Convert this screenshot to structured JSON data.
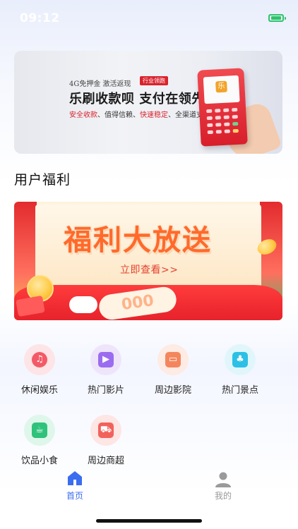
{
  "status_bar": {
    "time": "09:12"
  },
  "top_banner": {
    "promo_line": "4G免押金 激活返现",
    "tag": "行业领跑",
    "title": "乐刷收款呗 支付在领先",
    "features": [
      "安全收款",
      "值得信赖",
      "快速稳定",
      "全渠道支付"
    ],
    "device_logo": "乐"
  },
  "section": {
    "title": "用户福利"
  },
  "welfare_banner": {
    "title": "福利大放送",
    "cta": "立即查看>>",
    "ticket_text": "000"
  },
  "categories": [
    {
      "label": "休闲娱乐",
      "icon": "leisure-icon",
      "bg": "#fde4e6",
      "fg": "#f35a67",
      "glyph": "♫"
    },
    {
      "label": "热门影片",
      "icon": "movie-icon",
      "bg": "#efe5fb",
      "fg": "#9b6cf0",
      "glyph": "▶"
    },
    {
      "label": "周边影院",
      "icon": "cinema-icon",
      "bg": "#fdebe4",
      "fg": "#f4865d",
      "glyph": "▭"
    },
    {
      "label": "热门景点",
      "icon": "scenic-icon",
      "bg": "#e1f6fb",
      "fg": "#2cc0e6",
      "glyph": "♣"
    },
    {
      "label": "饮品小食",
      "icon": "drink-icon",
      "bg": "#dff7ea",
      "fg": "#2fc27a",
      "glyph": "☕"
    },
    {
      "label": "周边商超",
      "icon": "cart-icon",
      "bg": "#fde6e4",
      "fg": "#f2625c",
      "glyph": "⛟"
    }
  ],
  "tabs": [
    {
      "label": "首页",
      "active": true,
      "color": "#3b6df0"
    },
    {
      "label": "我的",
      "active": false,
      "color": "#999999"
    }
  ]
}
